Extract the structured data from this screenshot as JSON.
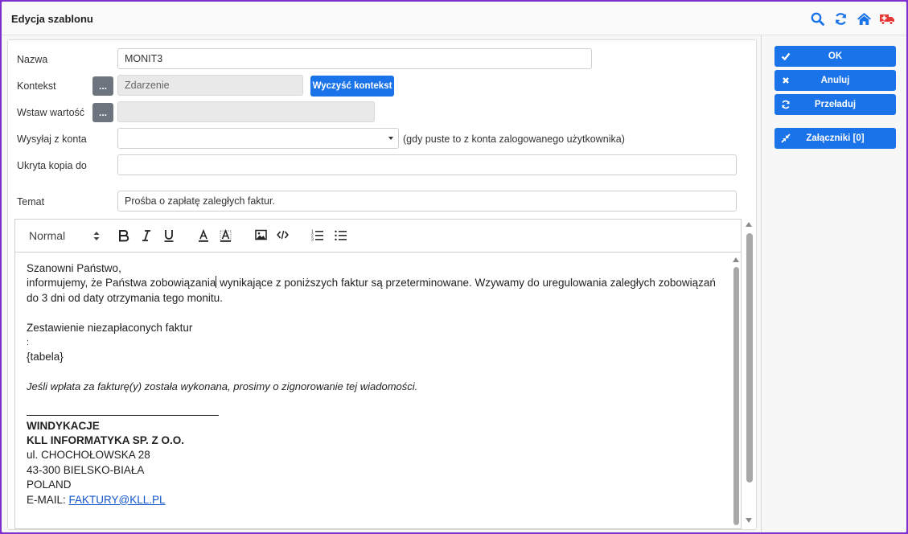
{
  "window": {
    "title": "Edycja szablonu",
    "icons": [
      "search-icon",
      "refresh-icon",
      "home-icon",
      "ambulance-icon"
    ],
    "accent_color": "#1a73e8",
    "border_color": "#7e2fd0"
  },
  "form": {
    "name_label": "Nazwa",
    "name_value": "MONIT3",
    "context_label": "Kontekst",
    "context_dots": "...",
    "context_placeholder": "Zdarzenie",
    "clear_context_label": "Wyczyść kontekst",
    "insert_label": "Wstaw wartość",
    "insert_dots": "...",
    "insert_value": "",
    "send_from_label": "Wysyłaj z konta",
    "send_from_value": "",
    "send_from_hint": "(gdy puste to z konta zalogowanego użytkownika)",
    "bcc_label": "Ukryta kopia do",
    "bcc_value": "",
    "subject_label": "Temat",
    "subject_value": "Prośba o zapłatę zaległych faktur."
  },
  "toolbar": {
    "format_value": "Normal",
    "tools": [
      "bold-icon",
      "italic-icon",
      "underline-icon",
      "text-color-icon",
      "background-color-icon",
      "image-icon",
      "code-icon",
      "ordered-list-icon",
      "bullet-list-icon"
    ]
  },
  "body": {
    "line1": "Szanowni Państwo,",
    "line2a": "informujemy, że Państwa zobowiązania",
    "line2b": " wynikające z poniższych faktur są przeterminowane. Wzywamy do uregulowania zaległych zobowiązań do 3 dni od daty otrzymania tego monitu.",
    "summary": "Zestawienie niezapłaconych  faktur",
    "colon": ":",
    "table_placeholder": "{tabela}",
    "note": "Jeśli wpłata za fakturę(y) została wykonana, prosimy o zignorowanie tej wiadomości.",
    "sig_dept": "WINDYKACJE",
    "sig_company": "KLL INFORMATYKA SP. Z O.O.",
    "sig_street": "ul. CHOCHOŁOWSKA 28",
    "sig_city": "43-300 BIELSKO-BIAŁA",
    "sig_country": "POLAND",
    "sig_email_prefix": "E-MAIL: ",
    "sig_email": "FAKTURY@KLL.PL"
  },
  "side": {
    "ok_label": "OK",
    "cancel_label": "Anuluj",
    "reload_label": "Przeładuj",
    "attachments_label": "Załączniki [0]"
  }
}
